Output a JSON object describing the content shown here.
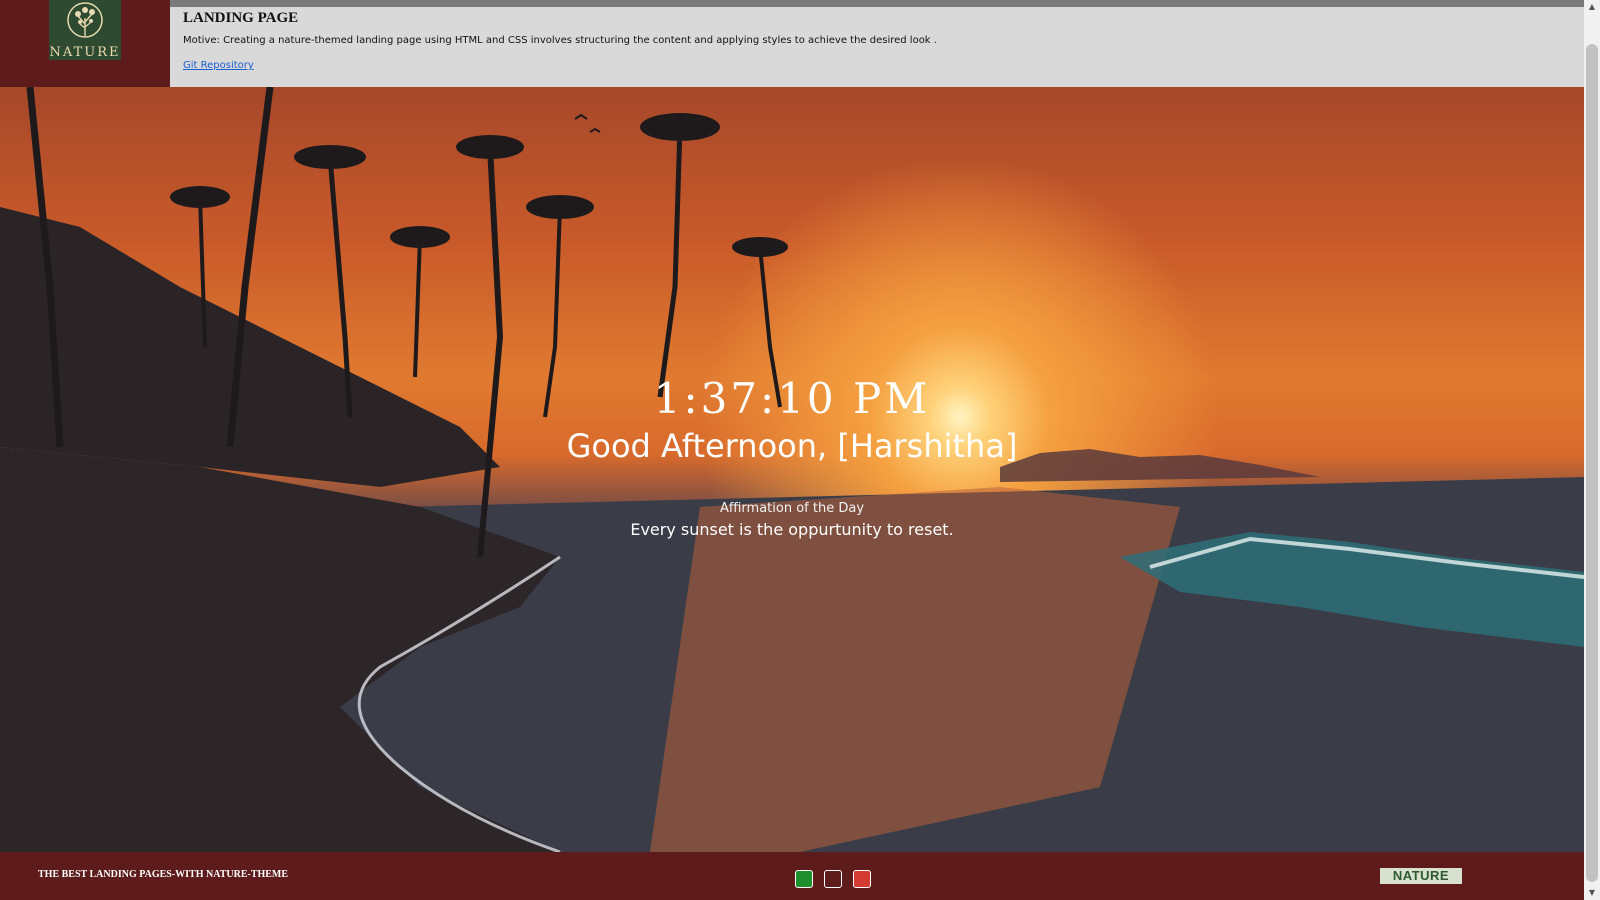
{
  "header": {
    "logo_text": "NATURE",
    "title": "LANDING PAGE",
    "motive": "Motive: Creating a nature-themed landing page using HTML and CSS involves structuring the content and applying styles to achieve the desired look .",
    "repo_link": "Git Repository"
  },
  "hero": {
    "time": "1:37:10 PM",
    "greeting": "Good Afternoon, [Harshitha]",
    "affirmation_label": "Affirmation of the Day",
    "affirmation_text": "Every sunset is the oppurtunity to reset."
  },
  "footer": {
    "tagline": "THE BEST LANDING PAGES-WITH NATURE-THEME",
    "swatches": [
      {
        "name": "green",
        "color": "#1f8f2e"
      },
      {
        "name": "dark",
        "color": "#5e1b1b"
      },
      {
        "name": "red",
        "color": "#d23a32"
      }
    ],
    "logo_text": "NATURE"
  },
  "colors": {
    "header_panel": "#5e1b1b",
    "info_panel": "#d9d9d9",
    "link": "#1a5fd0"
  }
}
